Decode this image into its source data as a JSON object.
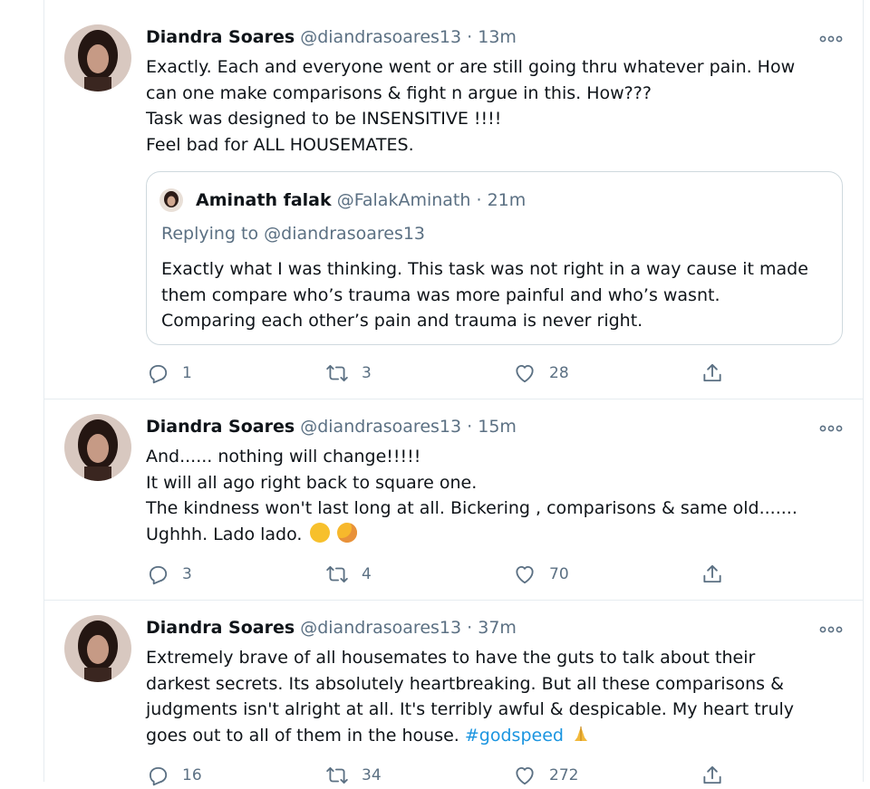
{
  "tweets": [
    {
      "name": "Diandra Soares",
      "handle": "@diandrasoares13",
      "separator": "·",
      "time": "13m",
      "lines": [
        "Exactly. Each and everyone went or are still going thru whatever pain. How",
        "can one make comparisons & fight n argue in this. How???",
        "Task was designed to be INSENSITIVE !!!!",
        "Feel bad for ALL HOUSEMATES."
      ],
      "quote": {
        "name": "Aminath falak",
        "handle": "@FalakAminath",
        "separator": "·",
        "time": "21m",
        "replying_to": "Replying to @diandrasoares13",
        "lines": [
          "Exactly what I was thinking. This task was not right in a way cause it made",
          "them compare who’s trauma was more painful and who’s wasnt.",
          "Comparing each other’s pain and trauma is never right."
        ]
      },
      "replies": "1",
      "retweets": "3",
      "likes": "28"
    },
    {
      "name": "Diandra Soares",
      "handle": "@diandrasoares13",
      "separator": "·",
      "time": "15m",
      "lines": [
        "And...... nothing will change!!!!!",
        "It will all ago right back to square one.",
        "The kindness won't last long at all. Bickering , comparisons & same old.......",
        "Ughhh.  Lado lado."
      ],
      "emojis": [
        "upside-down-face-emoji",
        "face-with-hand-over-mouth-emoji"
      ],
      "replies": "3",
      "retweets": "4",
      "likes": "70"
    },
    {
      "name": "Diandra Soares",
      "handle": "@diandrasoares13",
      "separator": "·",
      "time": "37m",
      "lines": [
        "Extremely brave of all housemates to have the guts to talk about their",
        "darkest secrets. Its absolutely heartbreaking. But all these comparisons &",
        "judgments isn't alright at all. It's terribly awful & despicable. My heart truly",
        "goes out to all of them in the house. "
      ],
      "hashtag": "#godspeed",
      "emojis": [
        "folded-hands-emoji"
      ],
      "replies": "16",
      "retweets": "34",
      "likes": "272"
    }
  ],
  "icons": {
    "more": "more-dots-icon",
    "reply": "reply-icon",
    "retweet": "retweet-icon",
    "like": "heart-icon",
    "share": "share-icon"
  },
  "colors": {
    "text": "#0f1419",
    "secondary": "#5b7083",
    "link": "#1b95e0",
    "border": "#e6ecf0"
  }
}
